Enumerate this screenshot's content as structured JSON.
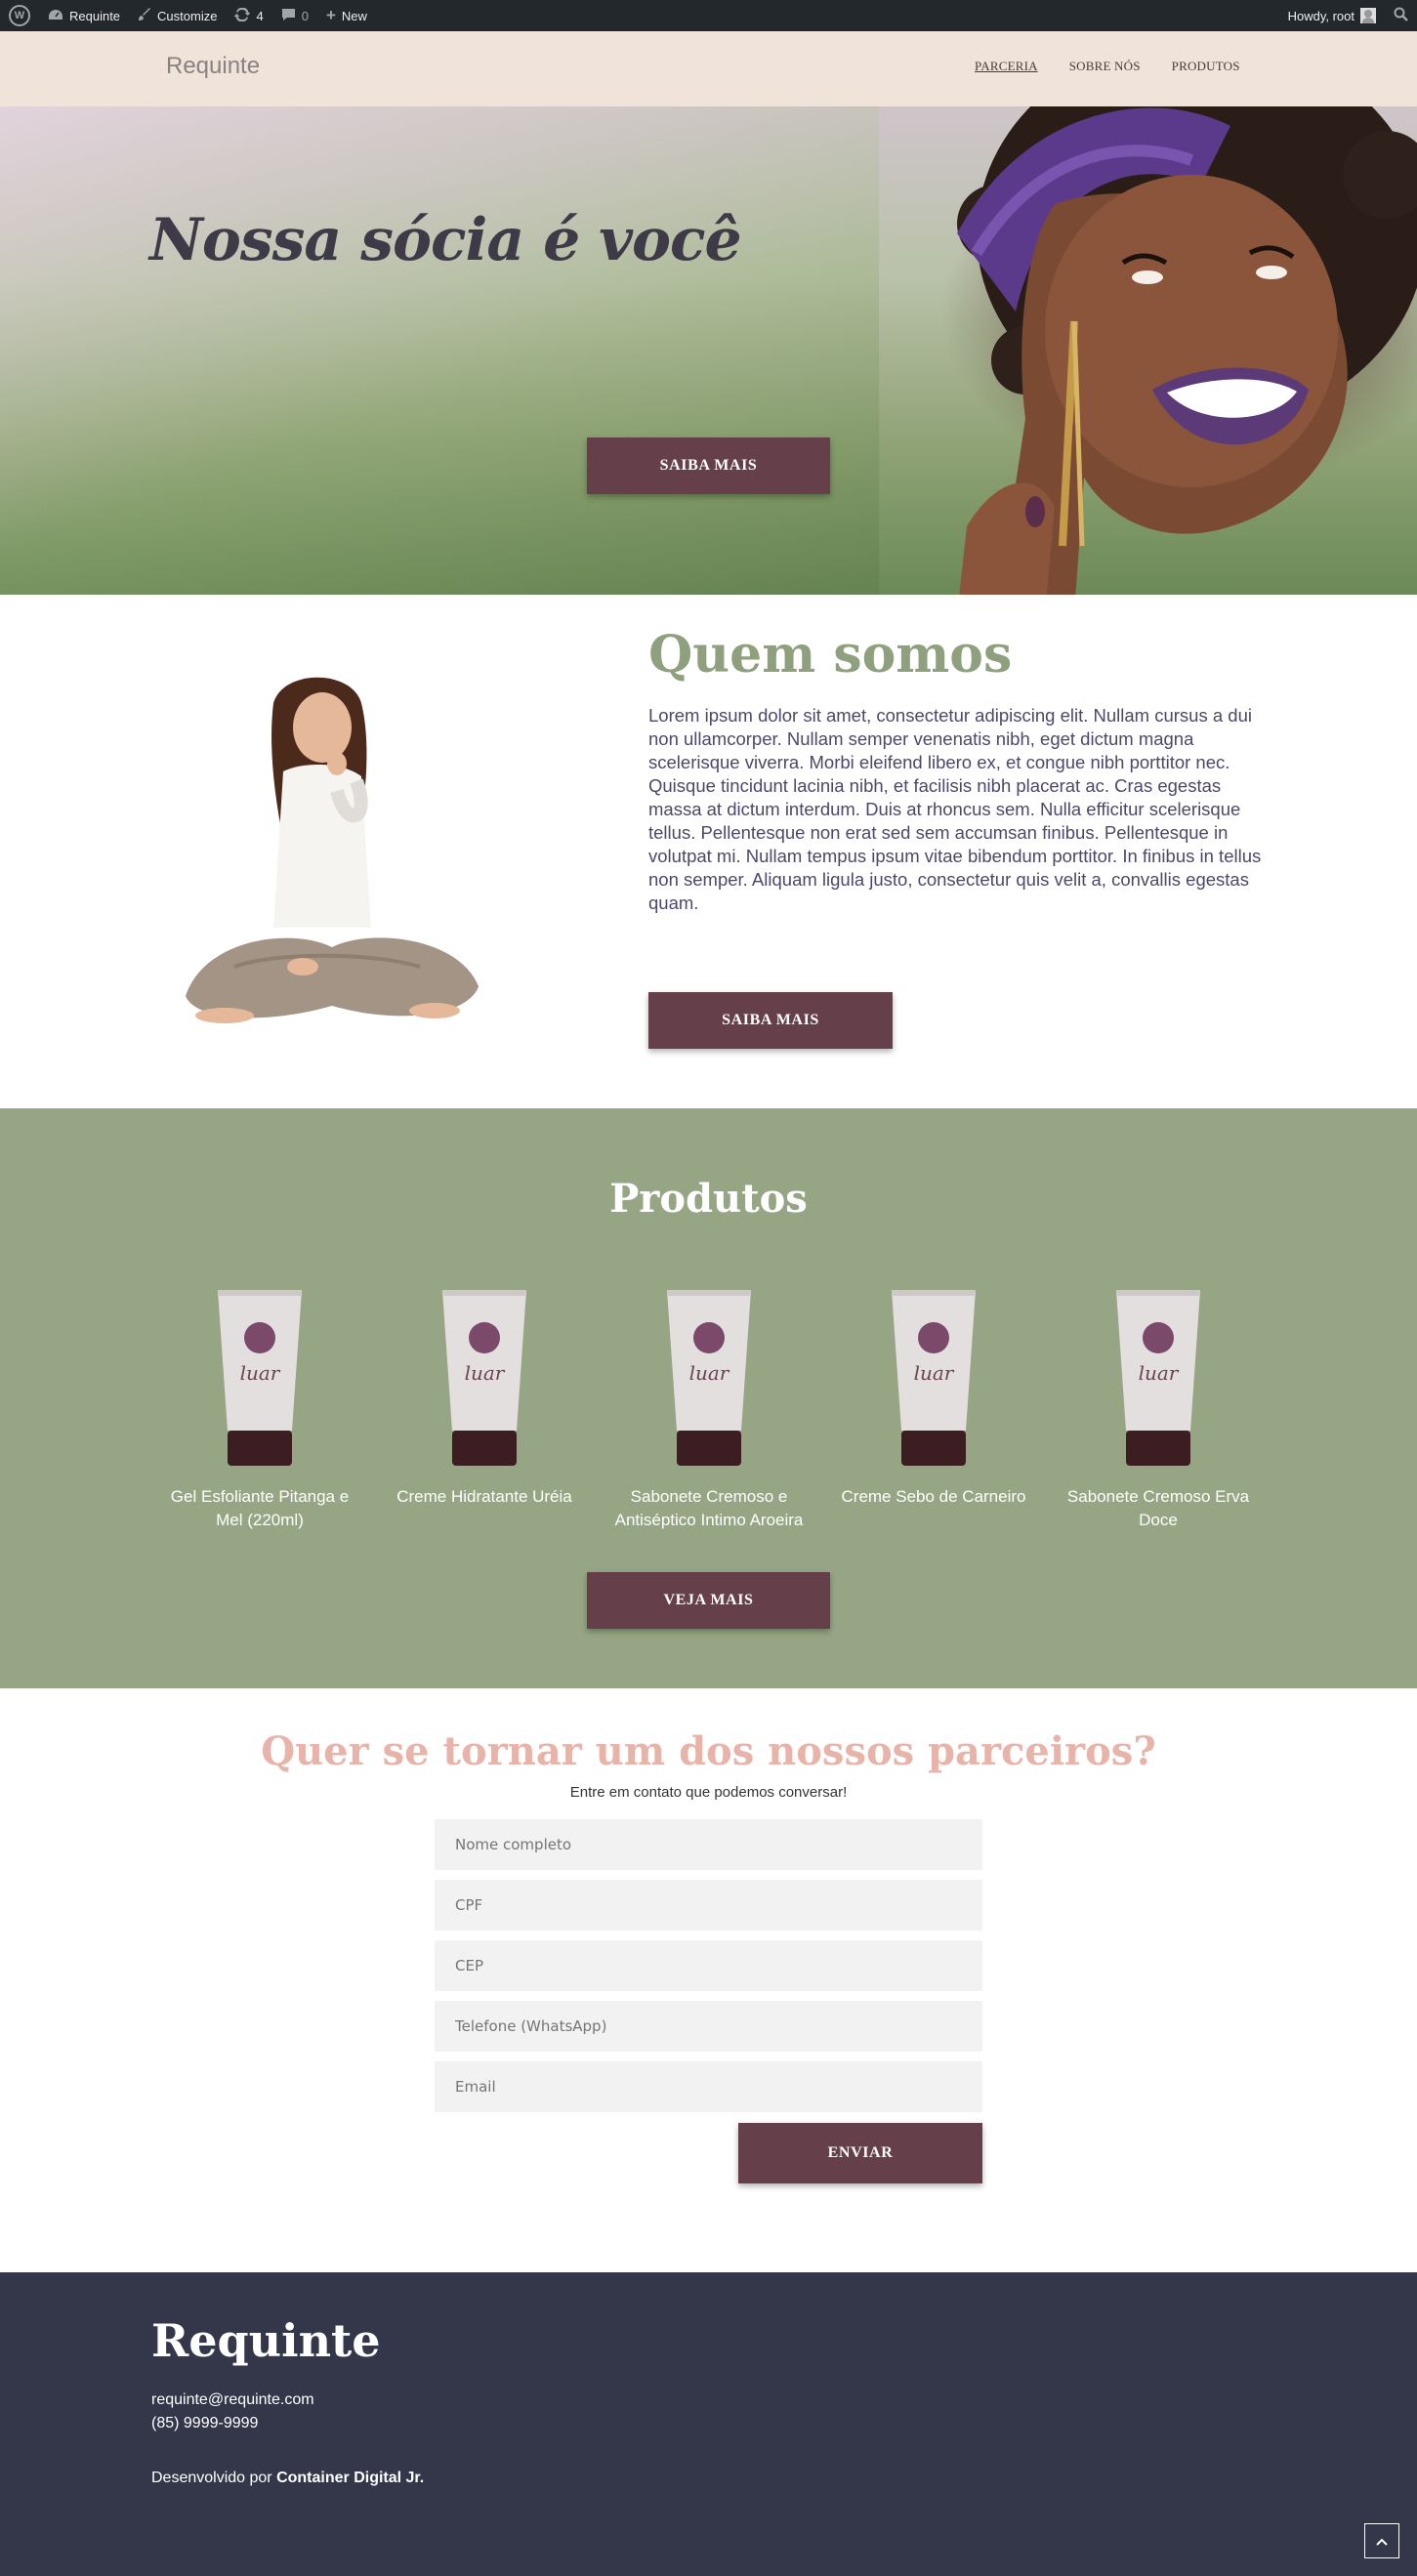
{
  "adminbar": {
    "site_name": "Requinte",
    "customize": "Customize",
    "updates": "4",
    "comments": "0",
    "new": "New",
    "howdy": "Howdy, root"
  },
  "header": {
    "brand": "Requinte",
    "nav": [
      "PARCERIA",
      "SOBRE NÓS",
      "PRODUTOS"
    ]
  },
  "hero": {
    "title": "Nossa sócia é você",
    "button": "SAIBA MAIS"
  },
  "about": {
    "title": "Quem somos",
    "text": "Lorem ipsum dolor sit amet, consectetur adipiscing elit. Nullam cursus a dui non ullamcorper. Nullam semper venenatis nibh, eget dictum magna scelerisque viverra. Morbi eleifend libero ex, et congue nibh porttitor nec. Quisque tincidunt lacinia nibh, et facilisis nibh placerat ac. Cras egestas massa at dictum interdum. Duis at rhoncus sem. Nulla efficitur scelerisque tellus. Pellentesque non erat sed sem accumsan finibus. Pellentesque in volutpat mi. Nullam tempus ipsum vitae bibendum porttitor. In finibus in tellus non semper. Aliquam ligula justo, consectetur quis velit a, convallis egestas quam.",
    "button": "SAIBA MAIS"
  },
  "products": {
    "title": "Produtos",
    "items": [
      {
        "name": "Gel Esfoliante Pitanga e Mel (220ml)",
        "tube_brand": "luar"
      },
      {
        "name": "Creme Hidratante Uréia",
        "tube_brand": "luar"
      },
      {
        "name": "Sabonete Cremoso e Antiséptico Intimo Aroeira",
        "tube_brand": "luar"
      },
      {
        "name": "Creme Sebo de Carneiro",
        "tube_brand": "luar"
      },
      {
        "name": "Sabonete Cremoso Erva Doce",
        "tube_brand": "luar"
      }
    ],
    "button": "VEJA MAIS"
  },
  "contact": {
    "title": "Quer se tornar um dos nossos parceiros?",
    "subtitle": "Entre em contato que podemos conversar!",
    "fields": [
      {
        "placeholder": "Nome completo",
        "value": ""
      },
      {
        "placeholder": "CPF",
        "value": ""
      },
      {
        "placeholder": "CEP",
        "value": ""
      },
      {
        "placeholder": "Telefone (WhatsApp)",
        "value": ""
      },
      {
        "placeholder": "Email",
        "value": ""
      }
    ],
    "submit": "ENVIAR"
  },
  "footer": {
    "brand": "Requinte",
    "email": "requinte@requinte.com",
    "phone": "(85) 9999-9999",
    "credit_prefix": "Desenvolvido por ",
    "credit_name": "Container Digital Jr."
  },
  "colors": {
    "admin_bar": "#23282d",
    "header_bg": "#efe3da",
    "button": "#65404a",
    "about_title": "#8fa07e",
    "products_bg": "#96a685",
    "contact_title": "#e8b3a8",
    "footer_bg": "#34364a"
  },
  "icons": [
    "wordpress-icon",
    "dashboard-icon",
    "brush-icon",
    "updates-icon",
    "comment-icon",
    "plus-icon",
    "search-icon",
    "chevron-up-icon"
  ]
}
